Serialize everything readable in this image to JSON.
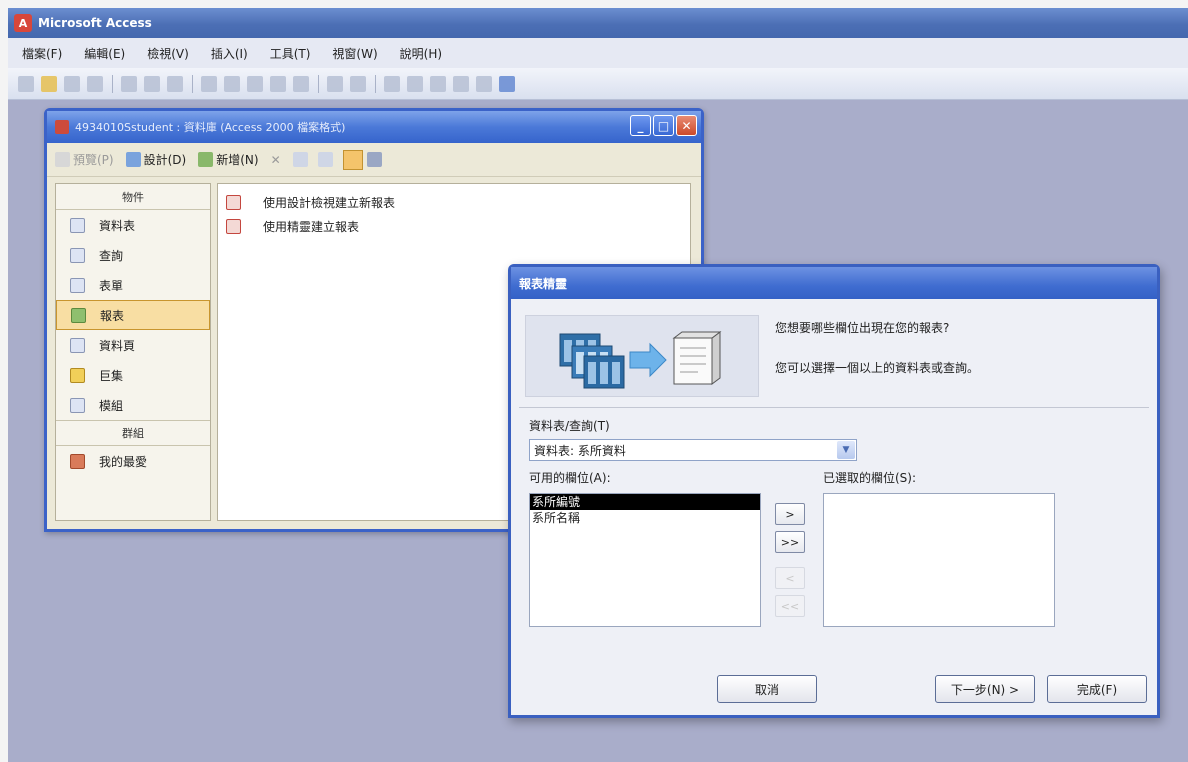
{
  "app": {
    "title": "Microsoft Access",
    "logo_letter": "A"
  },
  "menu": [
    "檔案(F)",
    "編輯(E)",
    "檢視(V)",
    "插入(I)",
    "工具(T)",
    "視窗(W)",
    "說明(H)"
  ],
  "db_window": {
    "title": "4934010Sstudent : 資料庫 (Access 2000 檔案格式)",
    "toolbar": {
      "preview": "預覽(P)",
      "design": "設計(D)",
      "new": "新增(N)",
      "delete": "✕"
    },
    "objects_header": "物件",
    "objects": [
      {
        "label": "資料表",
        "icon": "table-icon",
        "selected": false
      },
      {
        "label": "查詢",
        "icon": "query-icon",
        "selected": false
      },
      {
        "label": "表單",
        "icon": "form-icon",
        "selected": false
      },
      {
        "label": "報表",
        "icon": "report-icon",
        "selected": true
      },
      {
        "label": "資料頁",
        "icon": "page-icon",
        "selected": false
      },
      {
        "label": "巨集",
        "icon": "macro-icon",
        "selected": false
      },
      {
        "label": "模組",
        "icon": "module-icon",
        "selected": false
      }
    ],
    "groups_header": "群組",
    "groups": [
      {
        "label": "我的最愛",
        "icon": "favorites-icon"
      }
    ],
    "list_items": [
      "使用設計檢視建立新報表",
      "使用精靈建立報表"
    ]
  },
  "wizard": {
    "title": "報表精靈",
    "question": "您想要哪些欄位出現在您的報表?",
    "hint": "您可以選擇一個以上的資料表或查詢。",
    "table_query_label": "資料表/查詢(T)",
    "table_query_value": "資料表: 系所資料",
    "available_label": "可用的欄位(A):",
    "selected_label": "已選取的欄位(S):",
    "available_fields": [
      "系所編號",
      "系所名稱"
    ],
    "selected_fields": [],
    "move_one": ">",
    "move_all": ">>",
    "remove_one": "<",
    "remove_all": "<<",
    "buttons": {
      "cancel": "取消",
      "next": "下一步(N) >",
      "finish": "完成(F)"
    }
  }
}
